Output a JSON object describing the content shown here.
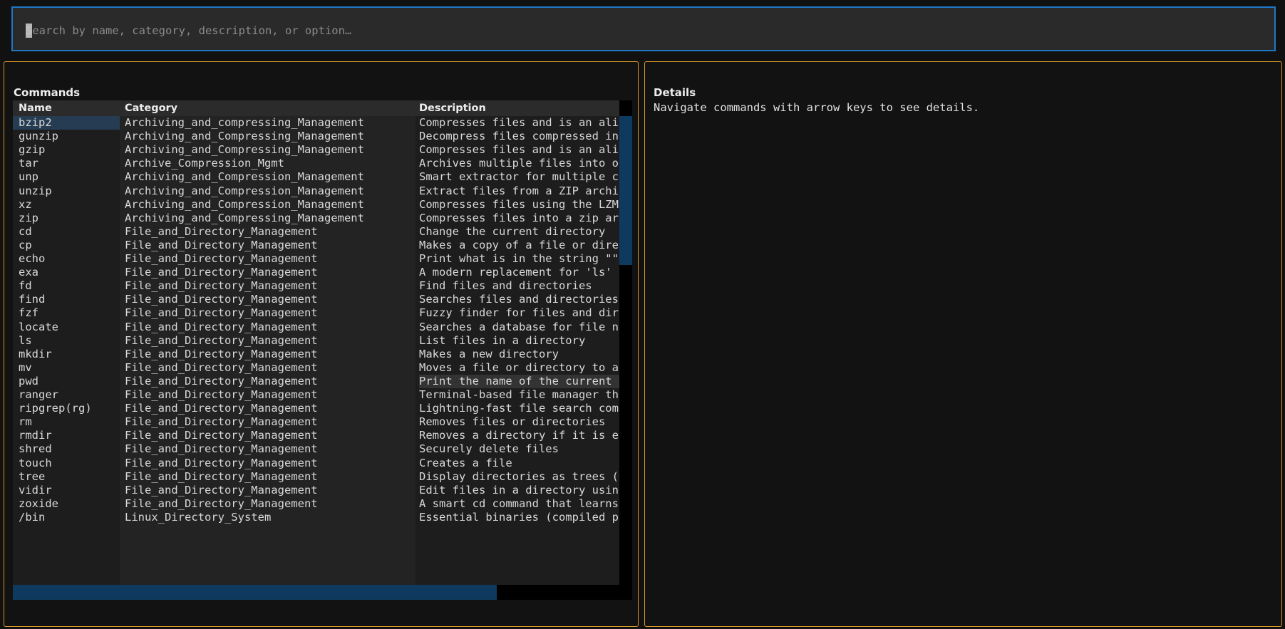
{
  "search": {
    "placeholder": "Search by name, category, description, or option…",
    "value": ""
  },
  "commands_panel": {
    "title": "Commands",
    "columns": [
      "Name",
      "Category",
      "Description"
    ],
    "selected_row": 0,
    "hover_row": 19,
    "rows": [
      {
        "name": "bzip2",
        "category": "Archiving_and_compressing_Management",
        "description": "Compresses files and is an ali"
      },
      {
        "name": "gunzip",
        "category": "Archiving_and_Compressing_Management",
        "description": "Decompress files compressed in"
      },
      {
        "name": "gzip",
        "category": "Archiving_and_Compressing_Management",
        "description": "Compresses files and is an ali"
      },
      {
        "name": "tar",
        "category": "Archive_Compression_Mgmt",
        "description": "Archives multiple files into o"
      },
      {
        "name": "unp",
        "category": "Archiving_and_Compression_Management",
        "description": "Smart extractor for multiple c"
      },
      {
        "name": "unzip",
        "category": "Archiving_and_Compression_Management",
        "description": "Extract files from a ZIP archi"
      },
      {
        "name": "xz",
        "category": "Archiving_and_Compression_Management",
        "description": "Compresses files using the LZM"
      },
      {
        "name": "zip",
        "category": "Archiving_and_Compressing_Management",
        "description": "Compresses files into a zip ar"
      },
      {
        "name": "cd",
        "category": "File_and_Directory_Management",
        "description": "Change the current directory"
      },
      {
        "name": "cp",
        "category": "File_and_Directory_Management",
        "description": "Makes a copy of a file or dire"
      },
      {
        "name": "echo",
        "category": "File_and_Directory_Management",
        "description": "Print what is in the string \"\""
      },
      {
        "name": "exa",
        "category": "File_and_Directory_Management",
        "description": "A modern replacement for 'ls'"
      },
      {
        "name": "fd",
        "category": "File_and_Directory_Management",
        "description": "Find files and directories"
      },
      {
        "name": "find",
        "category": "File_and_Directory_Management",
        "description": "Searches files and directories"
      },
      {
        "name": "fzf",
        "category": "File_and_Directory_Management",
        "description": "Fuzzy finder for files and dir"
      },
      {
        "name": "locate",
        "category": "File_and_Directory_Management",
        "description": "Searches a database for file n"
      },
      {
        "name": "ls",
        "category": "File_and_Directory_Management",
        "description": "List files in a directory"
      },
      {
        "name": "mkdir",
        "category": "File_and_Directory_Management",
        "description": "Makes a new directory"
      },
      {
        "name": "mv",
        "category": "File_and_Directory_Management",
        "description": "Moves a file or directory to a"
      },
      {
        "name": "pwd",
        "category": "File_and_Directory_Management",
        "description": "Print the name of the current"
      },
      {
        "name": "ranger",
        "category": "File_and_Directory_Management",
        "description": "Terminal-based file manager th"
      },
      {
        "name": "ripgrep(rg)",
        "category": "File_and_Directory_Management",
        "description": "Lightning-fast file search com"
      },
      {
        "name": "rm",
        "category": "File_and_Directory_Management",
        "description": "Removes files or directories"
      },
      {
        "name": "rmdir",
        "category": "File_and_Directory_Management",
        "description": "Removes a directory if it is e"
      },
      {
        "name": "shred",
        "category": "File_and_Directory_Management",
        "description": "Securely delete files"
      },
      {
        "name": "touch",
        "category": "File_and_Directory_Management",
        "description": "Creates a file"
      },
      {
        "name": "tree",
        "category": "File_and_Directory_Management",
        "description": "Display directories as trees ("
      },
      {
        "name": "vidir",
        "category": "File_and_Directory_Management",
        "description": "Edit files in a directory usin"
      },
      {
        "name": "zoxide",
        "category": "File_and_Directory_Management",
        "description": "A smart cd command that learns"
      },
      {
        "name": "/bin",
        "category": "Linux_Directory_System",
        "description": "Essential binaries (compiled p"
      }
    ]
  },
  "details_panel": {
    "title": "Details",
    "hint": "Navigate commands with arrow keys to see details."
  },
  "colors": {
    "search_border": "#1f78c8",
    "panel_border": "#d79a2b",
    "selection": "#253c52",
    "scroll_thumb": "#0f3a5f"
  }
}
